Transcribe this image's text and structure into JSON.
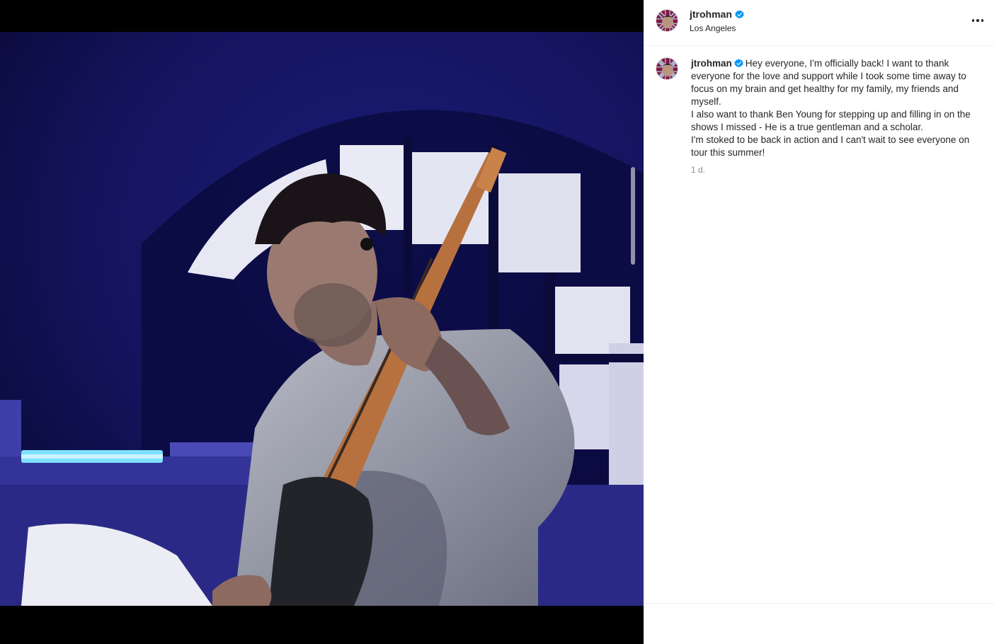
{
  "post": {
    "username": "jtrohman",
    "location": "Los Angeles",
    "caption": "Hey everyone, I'm officially back! I want to thank everyone for the love and support while I took some time away to focus on my brain and get healthy for my family, my friends and myself.\nI also want to thank Ben Young for stepping up and filling in on the shows I missed - He is a true gentleman and a scholar.\nI'm stoked to be back in action and I can't wait to see everyone on tour this summer!",
    "timestamp": "1 d.",
    "more_icon": "more-horizontal-icon",
    "verified_icon": "verified-badge-icon"
  },
  "colors": {
    "verified": "#0095f6",
    "text": "#262626",
    "muted": "#8e8e8e",
    "divider": "#efefef"
  }
}
